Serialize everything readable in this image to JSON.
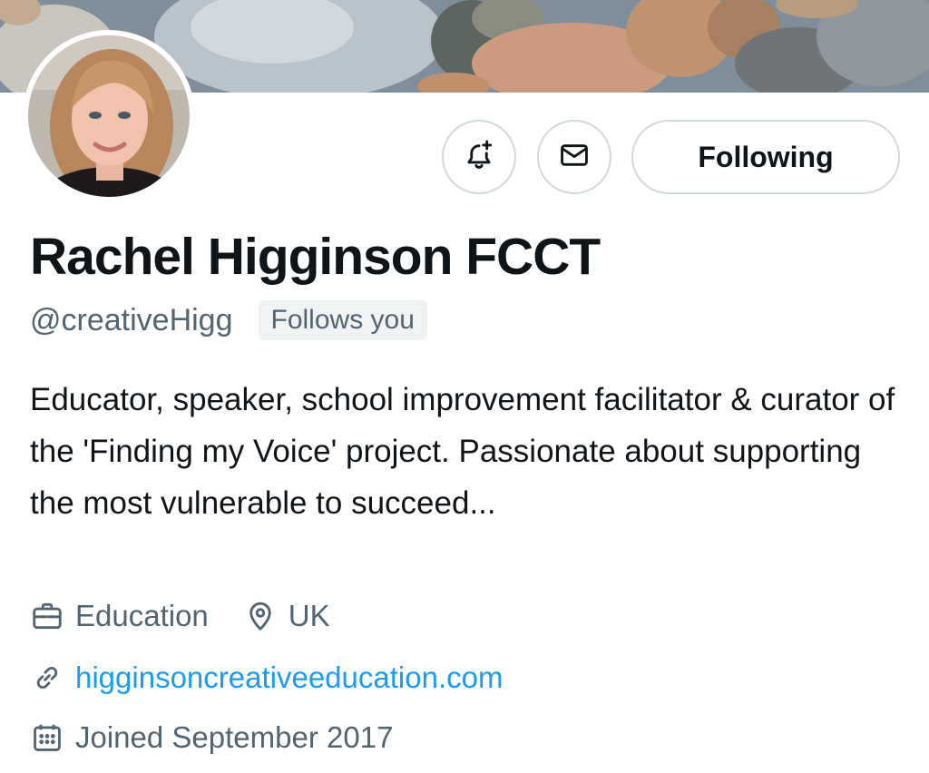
{
  "profile": {
    "display_name": "Rachel Higginson FCCT",
    "handle": "@creativeHigg",
    "follows_you_badge": "Follows you",
    "bio": "Educator, speaker, school improvement facilitator & curator of the 'Finding my Voice' project. Passionate about supporting the most vulnerable to succeed..."
  },
  "actions": {
    "notify_icon": "bell-plus-icon",
    "message_icon": "envelope-icon",
    "following_label": "Following"
  },
  "meta": {
    "category_icon": "briefcase-icon",
    "category": "Education",
    "location_icon": "location-pin-icon",
    "location": "UK",
    "link_icon": "link-icon",
    "website": "higginsoncreativeeducation.com",
    "joined_icon": "calendar-icon",
    "joined": "Joined September 2017"
  },
  "colors": {
    "text_primary": "#0f1419",
    "text_secondary": "#536471",
    "link": "#1d9bf0",
    "border": "#cfd9de",
    "badge_bg": "#eff3f4"
  }
}
